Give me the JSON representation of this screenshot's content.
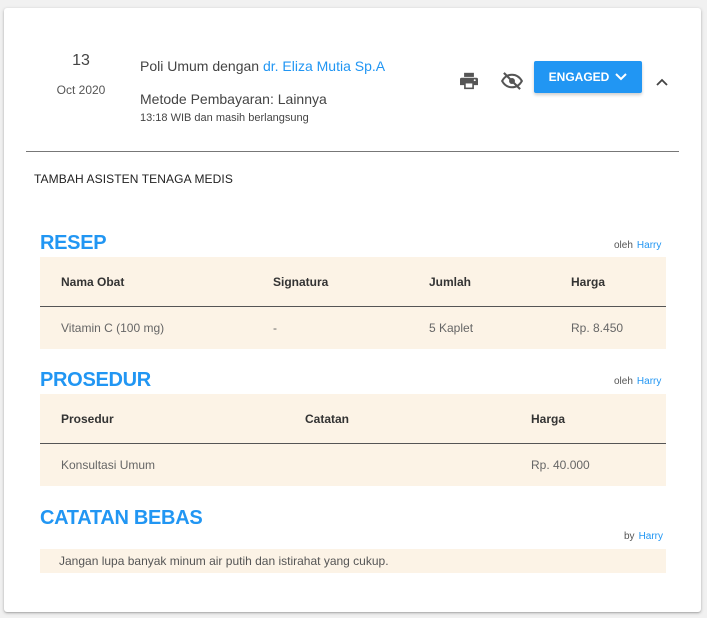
{
  "visit": {
    "day": "13",
    "month_year": "Oct 2020",
    "title_prefix": "Poli Umum dengan",
    "doctor": "dr. Eliza Mutia Sp.A",
    "payment_method": "Metode Pembayaran: Lainnya",
    "time_note": "13:18 WIB dan masih berlangsung"
  },
  "actions": {
    "print_icon": "printer-icon",
    "hide_icon": "eye-off-icon",
    "status_label": "ENGAGED",
    "collapse_icon": "chevron-up-icon"
  },
  "add_assistant_label": "TAMBAH ASISTEN TENAGA MEDIS",
  "resep": {
    "title": "RESEP",
    "by_label": "oleh",
    "author": "Harry",
    "columns": [
      "Nama Obat",
      "Signatura",
      "Jumlah",
      "Harga"
    ],
    "rows": [
      [
        "Vitamin C (100 mg)",
        "-",
        "5 Kaplet",
        "Rp. 8.450"
      ]
    ]
  },
  "prosedur": {
    "title": "PROSEDUR",
    "by_label": "oleh",
    "author": "Harry",
    "columns": [
      "Prosedur",
      "Catatan",
      "Harga"
    ],
    "rows": [
      [
        "Konsultasi Umum",
        "",
        "Rp. 40.000"
      ]
    ]
  },
  "catatan": {
    "title": "CATATAN BEBAS",
    "by_label": "by",
    "author": "Harry",
    "text": "Jangan lupa banyak minum air putih dan istirahat yang cukup."
  },
  "colors": {
    "accent": "#2196f3",
    "table_bg": "#fcf3e6"
  }
}
